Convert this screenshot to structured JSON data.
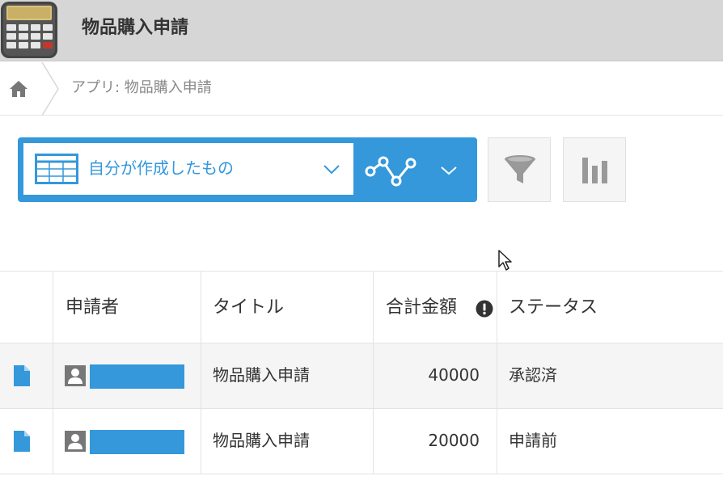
{
  "app": {
    "title": "物品購入申請"
  },
  "breadcrumb": {
    "path": "アプリ: 物品購入申請"
  },
  "toolbar": {
    "view_name": "自分が作成したもの",
    "accent_color": "#3498db"
  },
  "table": {
    "headers": [
      "申請者",
      "タイトル",
      "合計金額",
      "ステータス"
    ],
    "rows": [
      {
        "title": "物品購入申請",
        "amount": "40000",
        "status": "承認済"
      },
      {
        "title": "物品購入申請",
        "amount": "20000",
        "status": "申請前"
      }
    ]
  },
  "icons": {
    "app": "calculator-icon",
    "home": "home-icon",
    "view": "list-view-icon",
    "graph": "line-graph-icon",
    "filter": "funnel-icon",
    "chart": "bar-chart-icon",
    "record": "document-icon",
    "user": "user-avatar-icon",
    "info": "exclamation-icon"
  }
}
